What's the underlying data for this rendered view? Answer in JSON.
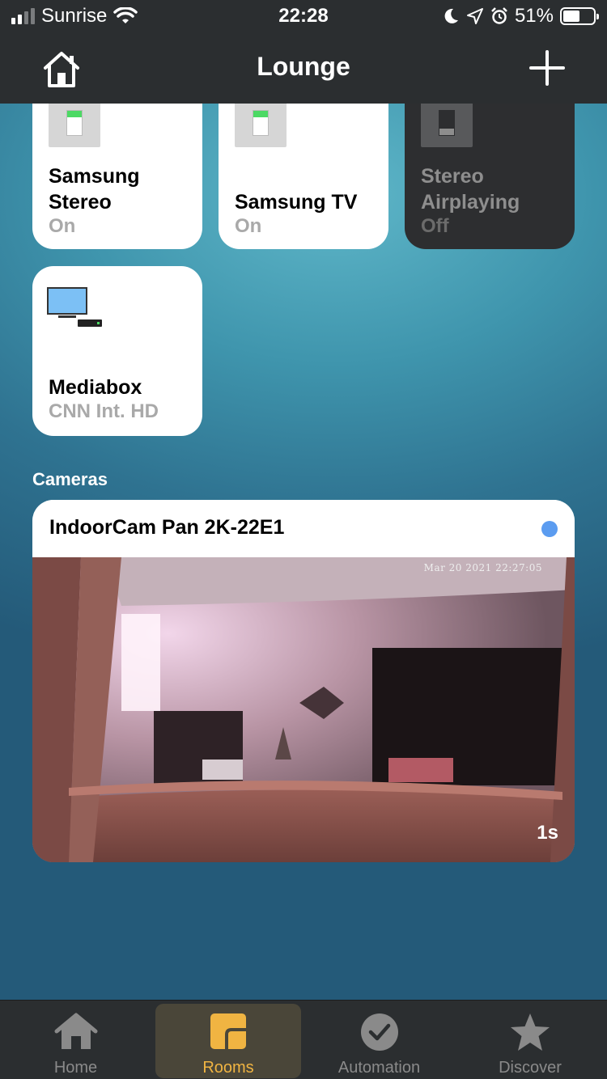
{
  "status_bar": {
    "carrier": "Sunrise",
    "time": "22:28",
    "battery": "51%"
  },
  "nav": {
    "title": "Lounge"
  },
  "accessories": [
    {
      "name_line1": "Samsung",
      "name_line2": "Stereo",
      "status": "On",
      "state": "on"
    },
    {
      "name_line1": "Samsung TV",
      "name_line2": "",
      "status": "On",
      "state": "on"
    },
    {
      "name_line1": "Stereo",
      "name_line2": "Airplaying",
      "status": "Off",
      "state": "off"
    },
    {
      "name_line1": "Mediabox",
      "name_line2": "",
      "status": "CNN Int. HD",
      "state": "on"
    }
  ],
  "cameras": {
    "section_title": "Cameras",
    "items": [
      {
        "name": "IndoorCam Pan 2K-22E1",
        "timestamp": "Mar 20 2021   22:27:05",
        "age": "1s",
        "status_color": "#5b9cf0"
      }
    ]
  },
  "tab_bar": {
    "items": [
      {
        "label": "Home",
        "icon": "house-icon"
      },
      {
        "label": "Rooms",
        "icon": "rooms-icon",
        "active": true
      },
      {
        "label": "Automation",
        "icon": "clock-check-icon"
      },
      {
        "label": "Discover",
        "icon": "star-icon"
      }
    ]
  },
  "colors": {
    "accent": "#f0b442",
    "bar_bg": "#2b2e30",
    "on_indicator": "#4cd964"
  }
}
